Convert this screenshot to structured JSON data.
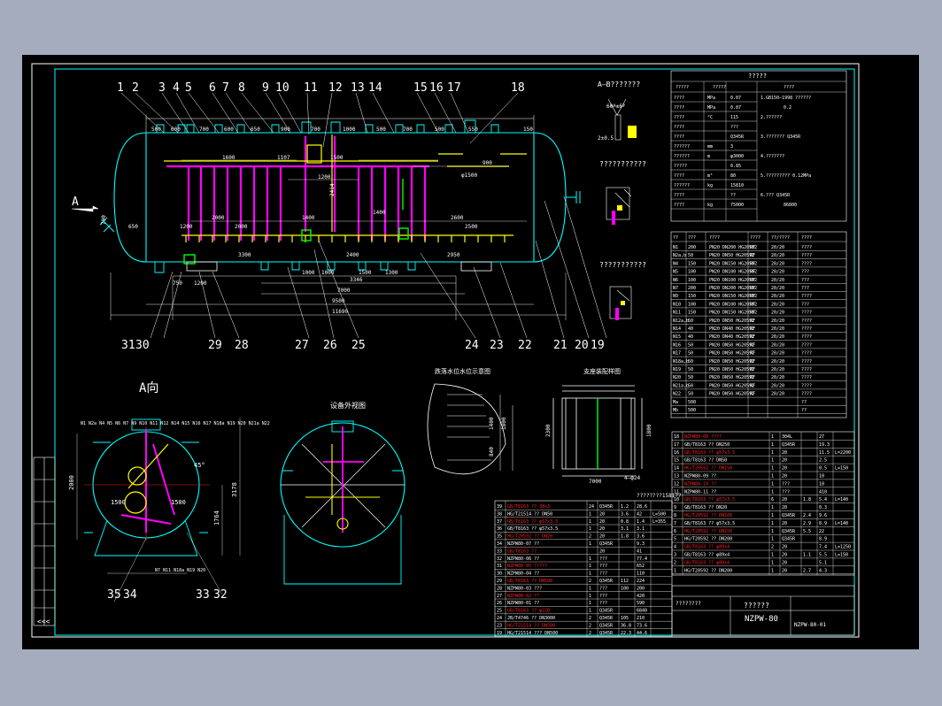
{
  "drawing": {
    "title_block_name": "??????",
    "model": "NZPW-80",
    "drawing_no": "NZPW-80-01",
    "view_a_label": "A向",
    "arrow_label": "A",
    "section_label": "A–B???????",
    "weld_label_1": "???????????",
    "weld_label_2": "???????????",
    "view3_label": "设备外视图",
    "detail1_label": "跌落水位水位示意图",
    "detail2_label": "支座装配样图"
  },
  "balloons_top": [
    "1",
    "2",
    "3",
    "4",
    "5",
    "6",
    "7",
    "8",
    "9",
    "10",
    "11",
    "12",
    "13",
    "14",
    "15",
    "16",
    "17",
    "18"
  ],
  "balloons_bottom": [
    "31",
    "30",
    "29",
    "28",
    "27",
    "26",
    "25",
    "24",
    "23",
    "22",
    "21",
    "20",
    "19"
  ],
  "balloons_endview": [
    "35",
    "34",
    "33",
    "32"
  ],
  "dims_top": [
    "500",
    "600",
    "700",
    "600",
    "650",
    "900",
    "700",
    "1000",
    "500",
    "700",
    "500",
    "550",
    "150"
  ],
  "dims_inner": [
    "1600",
    "1107",
    "1500",
    "1200",
    "2414",
    "φ1500",
    "900",
    "1400",
    "2000",
    "2600",
    "1400",
    "2500",
    "2000",
    "1200",
    "650",
    "700"
  ],
  "dims_bottom": [
    "3300",
    "2400",
    "2950",
    "1000",
    "1000",
    "1500",
    "1300",
    "3346",
    "7000",
    "9500",
    "11690",
    "750",
    "1200"
  ],
  "dims_view_a": [
    "2000",
    "3178",
    "1764",
    "1500",
    "1500",
    "2374",
    "2300",
    "7000",
    "1800",
    "840",
    "1400",
    "4–φ24"
  ],
  "design_table": {
    "header": "?????",
    "col_headers": [
      "?????",
      "?????",
      "????"
    ],
    "rows": [
      [
        "????",
        "MPa",
        "0.07",
        ""
      ],
      [
        "????",
        "MPa",
        "0.07",
        "0.2"
      ],
      [
        "????",
        "°C",
        "115",
        ""
      ],
      [
        "????",
        "",
        "???",
        ""
      ],
      [
        "????",
        "",
        "Q345R",
        ""
      ],
      [
        "??????",
        "mm",
        "3",
        ""
      ],
      [
        "??????",
        "m",
        "φ3000",
        ""
      ],
      [
        "?????",
        "",
        "0.85",
        ""
      ],
      [
        "????",
        "m³",
        "80",
        ""
      ],
      [
        "??????",
        "kg",
        "15810",
        ""
      ],
      [
        "????",
        "",
        "??",
        ""
      ],
      [
        "????",
        "kg",
        "75000",
        "86800"
      ]
    ],
    "notes": [
      "1.GB150–1998 ??????",
      "2.??????",
      "3.??????? Q345R",
      "4.???????",
      "5.????????? 0.12MPa",
      "6.??? Q345R"
    ]
  },
  "nozzle_table": {
    "headers": [
      "??",
      "???",
      "????",
      "????",
      "??/????",
      "????"
    ],
    "rows": [
      [
        "N1",
        "200",
        "PN20 DN200 HG20592",
        "RF",
        "20/20",
        "????"
      ],
      [
        "N2a,b",
        "50",
        "PN20 DN50 HG20592",
        "RF",
        "20/20",
        "????"
      ],
      [
        "N4",
        "150",
        "PN20 DN150 HG20592",
        "RF",
        "20/20",
        "????"
      ],
      [
        "N5",
        "100",
        "PN20 DN100 HG20592",
        "RF",
        "20/20",
        "???"
      ],
      [
        "N6",
        "100",
        "PN20 DN100 HG20592",
        "RF",
        "20/20",
        "???"
      ],
      [
        "N7",
        "200",
        "PN20 DN200 HG20592",
        "RF",
        "20/20",
        "???"
      ],
      [
        "N9",
        "150",
        "PN20 DN150 HG20592",
        "RF",
        "20/20",
        "????"
      ],
      [
        "N10",
        "100",
        "PN20 DN100 HG20592",
        "RF",
        "20/20",
        "???"
      ],
      [
        "N11",
        "150",
        "PN20 DN150 HG20592",
        "RF",
        "20/20",
        "????"
      ],
      [
        "N12a,b",
        "50",
        "PN20 DN50 HG20592",
        "RF",
        "20/20",
        "????"
      ],
      [
        "N14",
        "40",
        "PN20 DN40 HG20592",
        "RF",
        "20/20",
        "????"
      ],
      [
        "N15",
        "40",
        "PN20 DN40 HG20592",
        "RF",
        "20/20",
        "????"
      ],
      [
        "N16",
        "50",
        "PN20 DN50 HG20592",
        "RF",
        "20/20",
        "????"
      ],
      [
        "N17",
        "50",
        "PN20 DN50 HG20592",
        "RF",
        "20/20",
        "????"
      ],
      [
        "N18a,b",
        "50",
        "PN20 DN50 HG20592",
        "RF",
        "20/20",
        "????"
      ],
      [
        "N19",
        "50",
        "PN20 DN50 HG20592",
        "RF",
        "20/20",
        "????"
      ],
      [
        "N20",
        "50",
        "PN20 DN50 HG20592",
        "RF",
        "20/20",
        "????"
      ],
      [
        "N21a,b",
        "50",
        "PN20 DN50 HG20592",
        "RF",
        "20/20",
        "????"
      ],
      [
        "N22",
        "50",
        "PN20 DN50 HG20592",
        "RF",
        "20/20",
        "????"
      ],
      [
        "Ma",
        "500",
        "",
        "",
        "",
        "??"
      ],
      [
        "Mb",
        "500",
        "",
        "",
        "",
        "??"
      ]
    ]
  },
  "bom_left": [
    [
      "39",
      "GB/T8163 ?? 38x3",
      "24",
      "Q345R",
      "1.2",
      "28.6",
      ""
    ],
    [
      "38",
      "HG/T21514 ?? DN50",
      "1",
      "20",
      "3.6",
      "42",
      "L=500"
    ],
    [
      "37",
      "GB/T8163 ?? φ57x3.5",
      "1",
      "20",
      "0.8",
      "1.4",
      "L=355"
    ],
    [
      "36",
      "GB/T8163 ?? φ57x3.5",
      "1",
      "20",
      "3.1",
      "3.1",
      ""
    ],
    [
      "35",
      "HG/T20592 ?? DN20",
      "2",
      "20",
      "1.8",
      "3.6",
      ""
    ],
    [
      "34",
      "NZPW80-07 ??",
      "1",
      "Q345R",
      "",
      "9.3",
      ""
    ],
    [
      "33",
      "GB/T8163 ??",
      "",
      "20",
      "",
      "41",
      ""
    ],
    [
      "32",
      "NZPW80-06 ??",
      "1",
      "???",
      "",
      "77.4",
      ""
    ],
    [
      "31",
      "NZPW80-05 ?????",
      "1",
      "???",
      "",
      "652",
      ""
    ],
    [
      "30",
      "NZPW80-04 ??",
      "1",
      "???",
      "",
      "110",
      ""
    ],
    [
      "29",
      "GB/T8163 ?? DN500",
      "2",
      "Q345R",
      "112",
      "224",
      ""
    ],
    [
      "28",
      "NZPW80-03 ???",
      "1",
      "???",
      "100",
      "200",
      ""
    ],
    [
      "27",
      "NZPW80-02 ??",
      "1",
      "???",
      "",
      "420",
      ""
    ],
    [
      "26",
      "NZPW80-01 ??",
      "1",
      "???",
      "",
      "590",
      ""
    ],
    [
      "25",
      "GB/T8163 ?? φ220",
      "1",
      "Q345R",
      "",
      "6840",
      ""
    ],
    [
      "24",
      "JB/T4746 ?? DN3000",
      "2",
      "Q345R",
      "105",
      "210",
      ""
    ],
    [
      "23",
      "HG/T21514 ?? DN500",
      "2",
      "Q345R",
      "36.8",
      "73.6",
      ""
    ],
    [
      "19",
      "HG/T21514 ??? DN500",
      "2",
      "Q345R",
      "22.3",
      "44.6",
      ""
    ]
  ],
  "bom_right": [
    [
      "18",
      "NZPW80-08 ????",
      "1",
      "304L",
      "",
      "27",
      ""
    ],
    [
      "17",
      "GB/T8163 ?? DN250",
      "1",
      "Q345R",
      "",
      "19.3",
      ""
    ],
    [
      "16",
      "GB/T8163 ?? φ57x3.5",
      "1",
      "20",
      "",
      "11.5",
      "L=2200"
    ],
    [
      "15",
      "GB/T8163 ?? DN50",
      "1",
      "20",
      "",
      "2.5",
      ""
    ],
    [
      "14",
      "HG/T20592 ?? DN150",
      "1",
      "20",
      "",
      "0.5",
      "L=150"
    ],
    [
      "13",
      "NZPW80-09 ??",
      "1",
      "20",
      "",
      "10",
      ""
    ],
    [
      "12",
      "NZPW80-10 ??",
      "1",
      "???",
      "",
      "10",
      ""
    ],
    [
      "11",
      "NZPW80-11 ??",
      "1",
      "???",
      "",
      "410",
      ""
    ],
    [
      "10",
      "GB/T8163 ?? φ57x3.5",
      "6",
      "20",
      "1.8",
      "5.4",
      "L=140"
    ],
    [
      "9",
      "GB/T8163 ?? DN20",
      "1",
      "20",
      "",
      "0.3",
      ""
    ],
    [
      "8",
      "HG/T20592 ?? DN100",
      "1",
      "Q345R",
      "2.4",
      "9.6",
      ""
    ],
    [
      "7",
      "GB/T8163 ?? φ57x3.5",
      "1",
      "20",
      "2.9",
      "8.9",
      "L=140"
    ],
    [
      "6",
      "HG/T20592 ?? DN150",
      "1",
      "Q345R",
      "5.5",
      "22",
      ""
    ],
    [
      "5",
      "HG/T20592 ?? DN200",
      "1",
      "Q345R",
      "",
      "8.9",
      ""
    ],
    [
      "4",
      "GB/T8163 ?? φ89x4",
      "2",
      "20",
      "",
      "7.4",
      "L=1250"
    ],
    [
      "3",
      "GB/T8163 ?? φ89x4",
      "1",
      "20",
      "1.1",
      "5.5",
      "L=150"
    ],
    [
      "2",
      "GB/T8163 ?? φ89x4",
      "1",
      "20",
      "",
      "5.1",
      ""
    ],
    [
      "1",
      "HG/T20592 ?? DN200",
      "1",
      "20",
      "2.7",
      "4.3",
      ""
    ]
  ],
  "bom_right_header": "????????1581??",
  "bom_footer": "????????"
}
